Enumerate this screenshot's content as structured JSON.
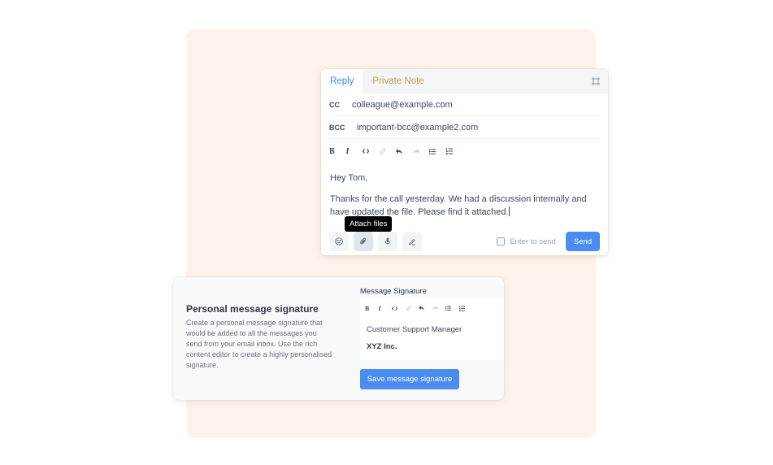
{
  "reply_editor": {
    "tabs": [
      {
        "label": "Reply",
        "active": true
      },
      {
        "label": "Private Note",
        "active": false
      }
    ],
    "expand_icon": "expand-icon",
    "cc": {
      "label": "CC",
      "value": "colleague@example.com"
    },
    "bcc": {
      "label": "BCC",
      "value": "important-bcc@example2.com"
    },
    "toolbar": [
      {
        "icon": "bold-icon",
        "glyph": "B"
      },
      {
        "icon": "italic-icon",
        "glyph": "I"
      },
      {
        "icon": "code-icon",
        "glyph": "<>"
      },
      {
        "icon": "link-icon",
        "glyph": "link",
        "disabled": true
      },
      {
        "icon": "undo-icon",
        "glyph": "undo"
      },
      {
        "icon": "redo-icon",
        "glyph": "redo",
        "disabled": true
      },
      {
        "icon": "bullet-list-icon",
        "glyph": "ul"
      },
      {
        "icon": "numbered-list-icon",
        "glyph": "ol"
      }
    ],
    "body": {
      "greeting": "Hey Tom,",
      "message": "Thanks for the call yesterday. We had a discussion internally and have updated the file. Please find it attached."
    },
    "tooltip": "Attach files",
    "actions": [
      {
        "icon": "emoji-icon"
      },
      {
        "icon": "paperclip-icon",
        "active": true
      },
      {
        "icon": "microphone-icon"
      },
      {
        "icon": "signature-icon"
      }
    ],
    "enter_to_send": {
      "label": "Enter to send",
      "checked": false
    },
    "send_label": "Send",
    "colors": {
      "accent": "#4a8cf0",
      "private_note": "#c79a4c"
    }
  },
  "signature_settings": {
    "title": "Personal message signature",
    "description": "Create a personal message signature that would be added to all the messages you send from your email inbox. Use the rich content editor to create a highly personalised signature.",
    "editor_label": "Message Signature",
    "signature_lines": [
      "Customer Support Manager",
      "XYZ Inc."
    ],
    "save_label": "Save message signature"
  },
  "backdrop_color": "#fdf3ea"
}
